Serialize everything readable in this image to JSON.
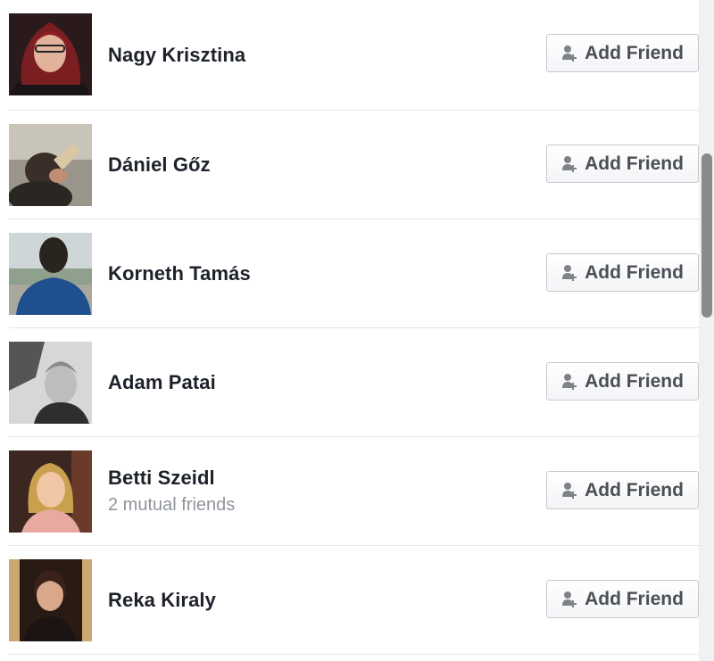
{
  "friend_suggestions": [
    {
      "name": "Nagy Krisztina",
      "mutual": "",
      "button_label": "Add Friend"
    },
    {
      "name": "Dániel Gőz",
      "mutual": "",
      "button_label": "Add Friend"
    },
    {
      "name": "Korneth Tamás",
      "mutual": "",
      "button_label": "Add Friend"
    },
    {
      "name": "Adam Patai",
      "mutual": "",
      "button_label": "Add Friend"
    },
    {
      "name": "Betti Szeidl",
      "mutual": "2 mutual friends",
      "button_label": "Add Friend"
    },
    {
      "name": "Reka Kiraly",
      "mutual": "",
      "button_label": "Add Friend"
    }
  ],
  "icons": {
    "add_friend": "add-friend-icon"
  },
  "colors": {
    "name_text": "#1d2129",
    "secondary_text": "#90949c",
    "button_text": "#4b4f56",
    "divider": "#e4e5e8"
  }
}
